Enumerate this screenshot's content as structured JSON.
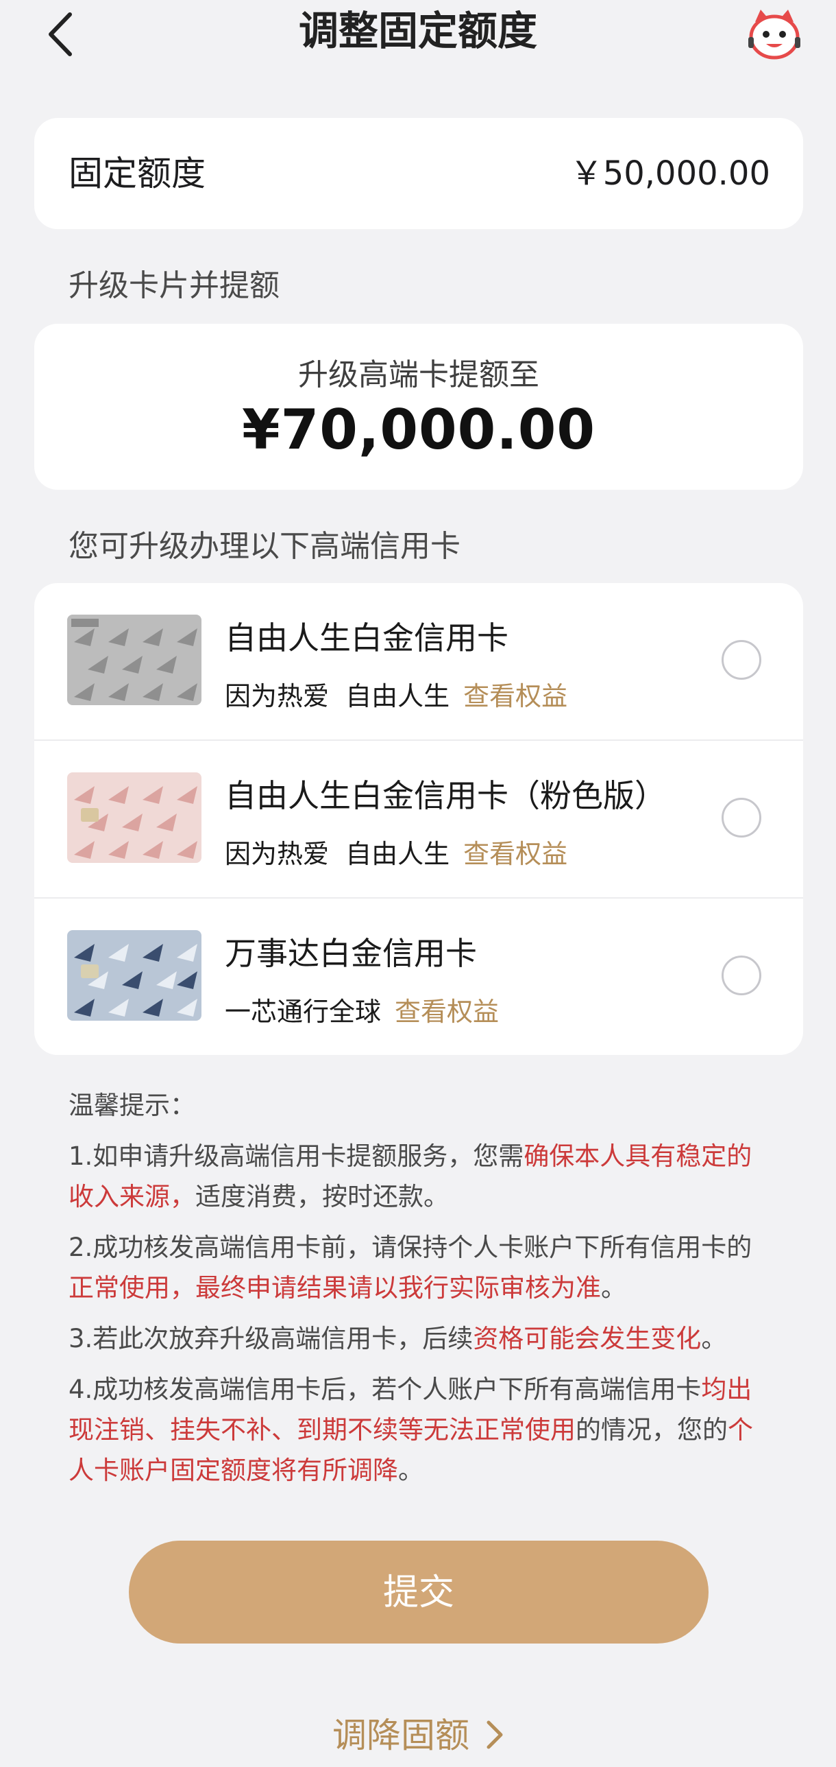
{
  "header": {
    "title": "调整固定额度"
  },
  "fixed_limit": {
    "label": "固定额度",
    "value": "￥50,000.00"
  },
  "upgrade_section": {
    "title": "升级卡片并提额",
    "card_label": "升级高端卡提额至",
    "amount": "¥70,000.00"
  },
  "options_section": {
    "title": "您可升级办理以下高端信用卡",
    "items": [
      {
        "name": "自由人生白金信用卡",
        "desc": "因为热爱  自由人生",
        "link": "查看权益",
        "style": "silver"
      },
      {
        "name": "自由人生白金信用卡（粉色版）",
        "desc": "因为热爱  自由人生",
        "link": "查看权益",
        "style": "pink"
      },
      {
        "name": "万事达白金信用卡",
        "desc": "一芯通行全球",
        "link": "查看权益",
        "style": "blue"
      }
    ]
  },
  "tips": {
    "title": "温馨提示：",
    "items": [
      [
        {
          "t": "1.如申请升级高端信用卡提额服务，您需"
        },
        {
          "t": "确保本人具有稳定的收入来源，",
          "h": true
        },
        {
          "t": "适度消费，按时还款。"
        }
      ],
      [
        {
          "t": "2.成功核发高端信用卡前，请保持个人卡账户下所有信用卡的"
        },
        {
          "t": "正常使用，最终申请结果请以我行实际审核为准",
          "h": true
        },
        {
          "t": "。"
        }
      ],
      [
        {
          "t": "3.若此次放弃升级高端信用卡，后续"
        },
        {
          "t": "资格可能会发生变化",
          "h": true
        },
        {
          "t": "。"
        }
      ],
      [
        {
          "t": "4.成功核发高端信用卡后，若个人账户下所有高端信用卡"
        },
        {
          "t": "均出现注销、挂失不补、到期不续等无法正常使用",
          "h": true
        },
        {
          "t": "的情况，您的"
        },
        {
          "t": "个人卡账户固定额度将有所调降",
          "h": true
        },
        {
          "t": "。"
        }
      ]
    ]
  },
  "submit_label": "提交",
  "reduce_label": "调降固额",
  "colors": {
    "accent": "#d2a777",
    "link": "#b58e58",
    "highlight": "#cc3a3a",
    "background": "#f2f2f4"
  }
}
